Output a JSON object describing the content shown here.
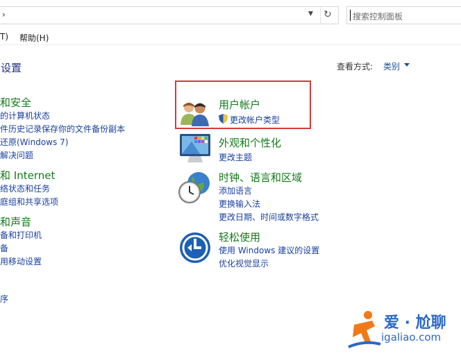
{
  "address_bar": {
    "chevron": "›",
    "dropdown_icon": "chevron-down-icon",
    "refresh_icon": "refresh-icon"
  },
  "search": {
    "placeholder": "搜索控制面板"
  },
  "menu": {
    "tools_fragment": "T)",
    "help": "帮助(H)"
  },
  "page": {
    "title": "设置",
    "view_label": "查看方式:",
    "view_value": "类别"
  },
  "left_categories": [
    {
      "title": "和安全",
      "links": [
        "的计算机状态",
        "件历史记录保存你的文件备份副本",
        "还原(Windows 7)",
        "解决问题"
      ]
    },
    {
      "title": "和 Internet",
      "links": [
        "络状态和任务",
        "庭组和共享选项"
      ]
    },
    {
      "title": "和声音",
      "links": [
        "备和打印机",
        "备",
        "用移动设置"
      ]
    },
    {
      "title": "",
      "links": [
        "序"
      ]
    }
  ],
  "right_categories": [
    {
      "title": "用户帐户",
      "icon": "users-icon",
      "links": [
        "更改帐户类型"
      ],
      "shield_icon": "shield-icon"
    },
    {
      "title": "外观和个性化",
      "icon": "monitor-icon",
      "links": [
        "更改主题"
      ]
    },
    {
      "title": "时钟、语言和区域",
      "icon": "clock-globe-icon",
      "links": [
        "添加语言",
        "更换输入法",
        "更改日期、时间或数字格式"
      ]
    },
    {
      "title": "轻松使用",
      "icon": "accessibility-icon",
      "links": [
        "使用 Windows 建议的设置",
        "优化视觉显示"
      ]
    }
  ],
  "watermark": {
    "line1": "爱 · 尬聊",
    "line2": "igaliao.com"
  },
  "colors": {
    "category_title": "#137a1a",
    "link": "#1a3fa0",
    "highlight": "#d33a3a",
    "watermark": "#2a67c8"
  }
}
